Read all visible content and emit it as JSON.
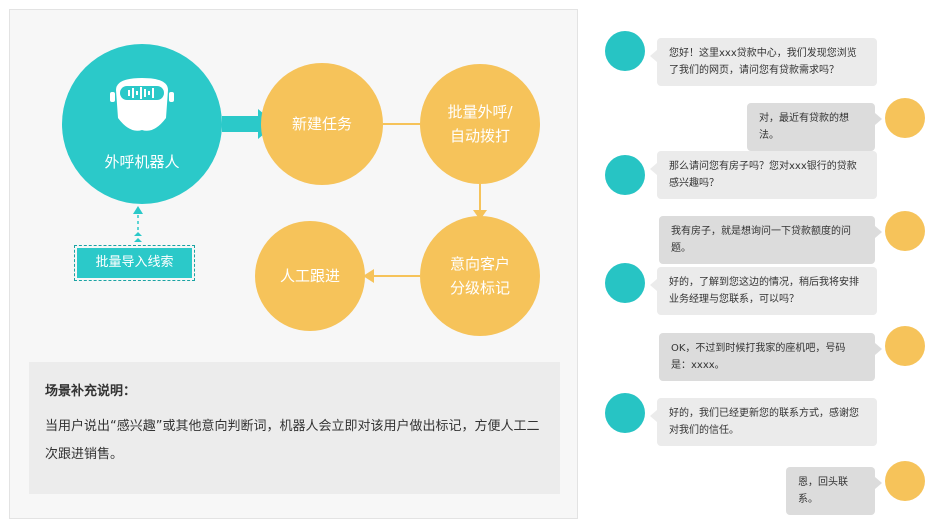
{
  "flow": {
    "robot_label": "外呼机器人",
    "task_label": "新建任务",
    "batch_call_label": "批量外呼/\n自动拨打",
    "grading_label": "意向客户\n分级标记",
    "manual_label": "人工跟进",
    "import_label": "批量导入线索"
  },
  "note": {
    "title": "场景补充说明：",
    "body": "当用户说出“感兴趣”或其他意向判断词，机器人会立即对该用户做出标记，方便人工二次跟进销售。"
  },
  "colors": {
    "teal": "#2bc9c9",
    "orange": "#f6c35a",
    "gray_bubble": "#ebebeb"
  },
  "chat": [
    {
      "role": "bot",
      "text": "您好！这里xxx贷款中心，我们发现您浏览了我们的网页，请问您有贷款需求吗？"
    },
    {
      "role": "user",
      "text": "对，最近有贷款的想法。"
    },
    {
      "role": "bot",
      "text": "那么请问您有房子吗？您对xxx银行的贷款感兴趣吗？"
    },
    {
      "role": "user",
      "text": "我有房子，就是想询问一下贷款额度的问题。"
    },
    {
      "role": "bot",
      "text": "好的，了解到您这边的情况，稍后我将安排业务经理与您联系，可以吗？"
    },
    {
      "role": "user",
      "text": "OK，不过到时候打我家的座机吧，号码是：xxxx。"
    },
    {
      "role": "bot",
      "text": "好的，我们已经更新您的联系方式，感谢您对我们的信任。"
    },
    {
      "role": "user",
      "text": "恩，回头联系。"
    }
  ]
}
